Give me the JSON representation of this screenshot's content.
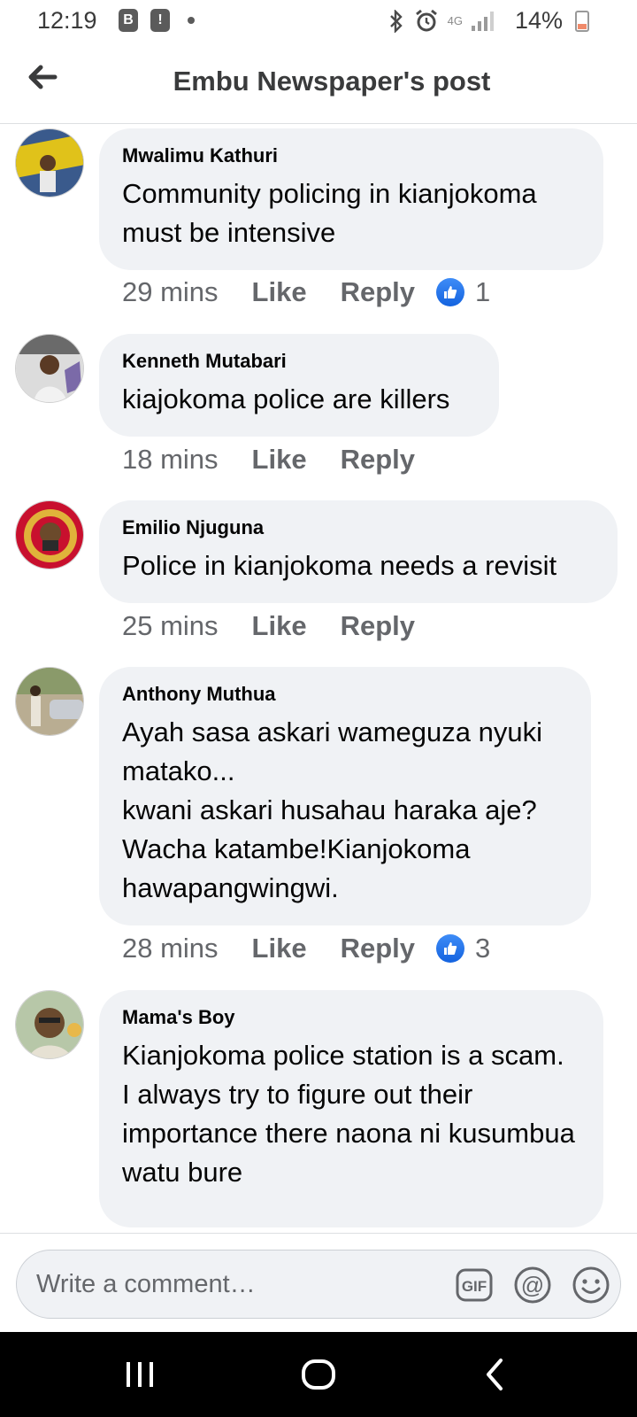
{
  "status_bar": {
    "time": "12:19",
    "network": "4G",
    "battery": "14%",
    "badge_letter": "B",
    "alert_mark": "!",
    "icons": [
      "bluetooth-icon",
      "alarm-icon",
      "signal-icon",
      "battery-icon"
    ]
  },
  "header": {
    "title": "Embu Newspaper's post",
    "back_icon": "back-arrow-icon"
  },
  "comments": [
    {
      "author": "Mwalimu Kathuri",
      "text": "Community policing in kianjokoma must be intensive",
      "time": "29 mins",
      "like_label": "Like",
      "reply_label": "Reply",
      "reactions": "1"
    },
    {
      "author": "Kenneth Mutabari",
      "text": "kiajokoma police are killers",
      "time": "18 mins",
      "like_label": "Like",
      "reply_label": "Reply"
    },
    {
      "author": "Emilio Njuguna",
      "text": "Police in kianjokoma needs a revisit",
      "time": "25 mins",
      "like_label": "Like",
      "reply_label": "Reply"
    },
    {
      "author": "Anthony Muthua",
      "text": "Ayah sasa askari wameguza nyuki matako...\nkwani askari husahau haraka aje?Wacha katambe!Kianjokoma hawapangwingwi.",
      "time": "28 mins",
      "like_label": "Like",
      "reply_label": "Reply",
      "reactions": "3"
    },
    {
      "author": "Mama's Boy",
      "text": "Kianjokoma police station is a scam.\nI always try to figure out their importance there naona ni kusumbua watu bure"
    }
  ],
  "composer": {
    "placeholder": "Write a comment…",
    "gif_label": "GIF",
    "at_label": "@",
    "icons": [
      "gif-icon",
      "mention-icon",
      "emoji-icon"
    ]
  },
  "colors": {
    "bubble_bg": "#f0f2f5",
    "meta_text": "#65676b",
    "like_blue": "#1877f2",
    "nav_bg": "#000000"
  }
}
